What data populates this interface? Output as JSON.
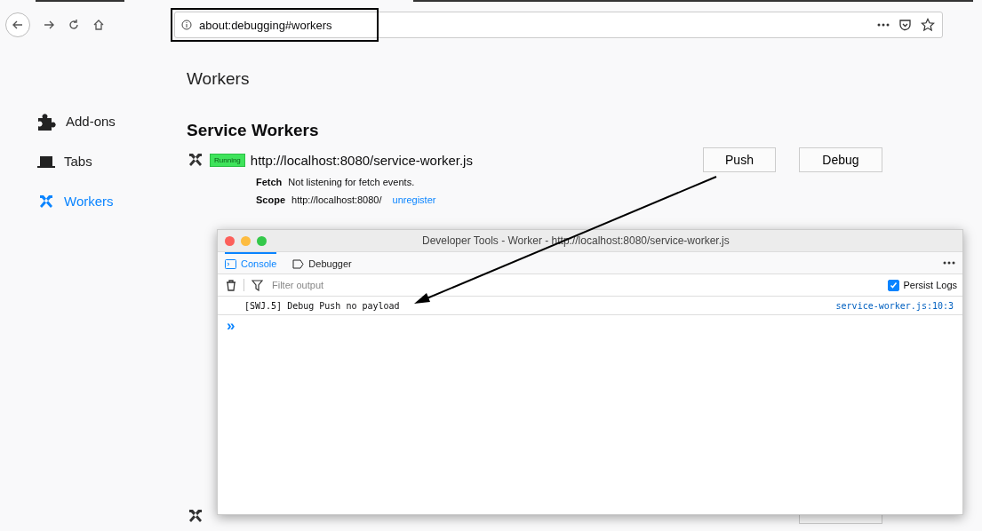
{
  "toolbar": {
    "url": "about:debugging#workers"
  },
  "sidebar": {
    "items": [
      {
        "label": "Add-ons",
        "selected": false
      },
      {
        "label": "Tabs",
        "selected": false
      },
      {
        "label": "Workers",
        "selected": true
      }
    ]
  },
  "main": {
    "title": "Workers",
    "section": "Service Workers",
    "workers": [
      {
        "status": "Running",
        "url": "http://localhost:8080/service-worker.js",
        "fetch_label": "Fetch",
        "fetch": "Not listening for fetch events.",
        "scope_label": "Scope",
        "scope": "http://localhost:8080/",
        "unregister": "unregister",
        "buttons": [
          "Push",
          "Debug"
        ]
      }
    ]
  },
  "devtools": {
    "title": "Developer Tools - Worker - http://localhost:8080/service-worker.js",
    "tabs": [
      {
        "label": "Console",
        "selected": true
      },
      {
        "label": "Debugger",
        "selected": false
      }
    ],
    "filter_placeholder": "Filter output",
    "persist_logs": {
      "label": "Persist Logs",
      "checked": true
    },
    "messages": [
      {
        "text": "[SWJ.5] Debug Push no payload",
        "source": "service-worker.js:10:3"
      }
    ],
    "prompt": "»"
  }
}
